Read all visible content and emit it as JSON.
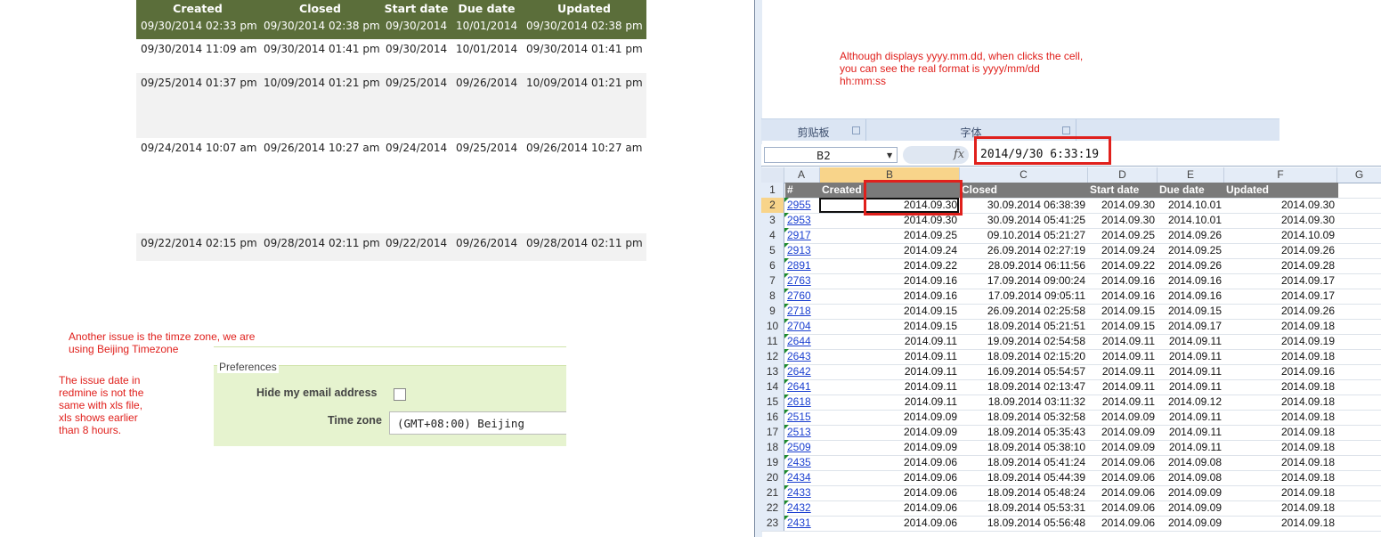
{
  "redmine": {
    "headers": [
      "Created",
      "Closed",
      "Start date",
      "Due date",
      "Updated"
    ],
    "rows": [
      [
        "09/30/2014 02:33 pm",
        "09/30/2014 02:38 pm",
        "09/30/2014",
        "10/01/2014",
        "09/30/2014 02:38 pm"
      ],
      [
        "09/30/2014 11:09 am",
        "09/30/2014 01:41 pm",
        "09/30/2014",
        "10/01/2014",
        "09/30/2014 01:41 pm"
      ],
      [
        "09/25/2014 01:37 pm",
        "10/09/2014 01:21 pm",
        "09/25/2014",
        "09/26/2014",
        "10/09/2014 01:21 pm"
      ],
      [
        "09/24/2014 10:07 am",
        "09/26/2014 10:27 am",
        "09/24/2014",
        "09/25/2014",
        "09/26/2014 10:27 am"
      ],
      [
        "09/22/2014 02:15 pm",
        "09/28/2014 02:11 pm",
        "09/22/2014",
        "09/26/2014",
        "09/28/2014 02:11 pm"
      ]
    ]
  },
  "notes": {
    "timezone_line1": "Another issue is the timze zone, we are",
    "timezone_line2": "using Beijing Timezone",
    "date_line1": "The issue date in",
    "date_line2": "redmine is not the",
    "date_line3": "same with xls file,",
    "date_line4": "xls shows earlier",
    "date_line5": "than 8 hours.",
    "format_line1": "Although displays yyyy.mm.dd, when clicks the cell,",
    "format_line2": "you can see the real format is yyyy/mm/dd",
    "format_line3": "hh:mm:ss"
  },
  "preferences": {
    "legend": "Preferences",
    "hide_email_label": "Hide my email address",
    "hide_email_checked": false,
    "timezone_label": "Time zone",
    "timezone_value": "(GMT+08:00) Beijing"
  },
  "excel": {
    "ribbon_groups": [
      "剪贴板",
      "字体"
    ],
    "name_box": "B2",
    "fx_icon": "fx",
    "formula_value": "2014/9/30  6:33:19",
    "columns": [
      "A",
      "B",
      "C",
      "D",
      "E",
      "F",
      "G"
    ],
    "header_row": [
      "#",
      "Created",
      "Closed",
      "Start date",
      "Due date",
      "Updated"
    ],
    "rows": [
      [
        "2955",
        "2014.09.30",
        "30.09.2014 06:38:39",
        "2014.09.30",
        "2014.10.01",
        "2014.09.30"
      ],
      [
        "2953",
        "2014.09.30",
        "30.09.2014 05:41:25",
        "2014.09.30",
        "2014.10.01",
        "2014.09.30"
      ],
      [
        "2917",
        "2014.09.25",
        "09.10.2014 05:21:27",
        "2014.09.25",
        "2014.09.26",
        "2014.10.09"
      ],
      [
        "2913",
        "2014.09.24",
        "26.09.2014 02:27:19",
        "2014.09.24",
        "2014.09.25",
        "2014.09.26"
      ],
      [
        "2891",
        "2014.09.22",
        "28.09.2014 06:11:56",
        "2014.09.22",
        "2014.09.26",
        "2014.09.28"
      ],
      [
        "2763",
        "2014.09.16",
        "17.09.2014 09:00:24",
        "2014.09.16",
        "2014.09.16",
        "2014.09.17"
      ],
      [
        "2760",
        "2014.09.16",
        "17.09.2014 09:05:11",
        "2014.09.16",
        "2014.09.16",
        "2014.09.17"
      ],
      [
        "2718",
        "2014.09.15",
        "26.09.2014 02:25:58",
        "2014.09.15",
        "2014.09.15",
        "2014.09.26"
      ],
      [
        "2704",
        "2014.09.15",
        "18.09.2014 05:21:51",
        "2014.09.15",
        "2014.09.17",
        "2014.09.18"
      ],
      [
        "2644",
        "2014.09.11",
        "19.09.2014 02:54:58",
        "2014.09.11",
        "2014.09.11",
        "2014.09.19"
      ],
      [
        "2643",
        "2014.09.11",
        "18.09.2014 02:15:20",
        "2014.09.11",
        "2014.09.11",
        "2014.09.18"
      ],
      [
        "2642",
        "2014.09.11",
        "16.09.2014 05:54:57",
        "2014.09.11",
        "2014.09.11",
        "2014.09.16"
      ],
      [
        "2641",
        "2014.09.11",
        "18.09.2014 02:13:47",
        "2014.09.11",
        "2014.09.11",
        "2014.09.18"
      ],
      [
        "2618",
        "2014.09.11",
        "18.09.2014 03:11:32",
        "2014.09.11",
        "2014.09.12",
        "2014.09.18"
      ],
      [
        "2515",
        "2014.09.09",
        "18.09.2014 05:32:58",
        "2014.09.09",
        "2014.09.11",
        "2014.09.18"
      ],
      [
        "2513",
        "2014.09.09",
        "18.09.2014 05:35:43",
        "2014.09.09",
        "2014.09.11",
        "2014.09.18"
      ],
      [
        "2509",
        "2014.09.09",
        "18.09.2014 05:38:10",
        "2014.09.09",
        "2014.09.11",
        "2014.09.18"
      ],
      [
        "2435",
        "2014.09.06",
        "18.09.2014 05:41:24",
        "2014.09.06",
        "2014.09.08",
        "2014.09.18"
      ],
      [
        "2434",
        "2014.09.06",
        "18.09.2014 05:44:39",
        "2014.09.06",
        "2014.09.08",
        "2014.09.18"
      ],
      [
        "2433",
        "2014.09.06",
        "18.09.2014 05:48:24",
        "2014.09.06",
        "2014.09.09",
        "2014.09.18"
      ],
      [
        "2432",
        "2014.09.06",
        "18.09.2014 05:53:31",
        "2014.09.06",
        "2014.09.09",
        "2014.09.18"
      ],
      [
        "2431",
        "2014.09.06",
        "18.09.2014 05:56:48",
        "2014.09.06",
        "2014.09.09",
        "2014.09.18"
      ]
    ]
  },
  "colors": {
    "annotation_red": "#e0201c",
    "redmine_header": "#5b6e3a",
    "prefs_bg": "#e6f3cf",
    "excel_header_row": "#7a7a7a",
    "excel_link": "#1a3fd0"
  }
}
